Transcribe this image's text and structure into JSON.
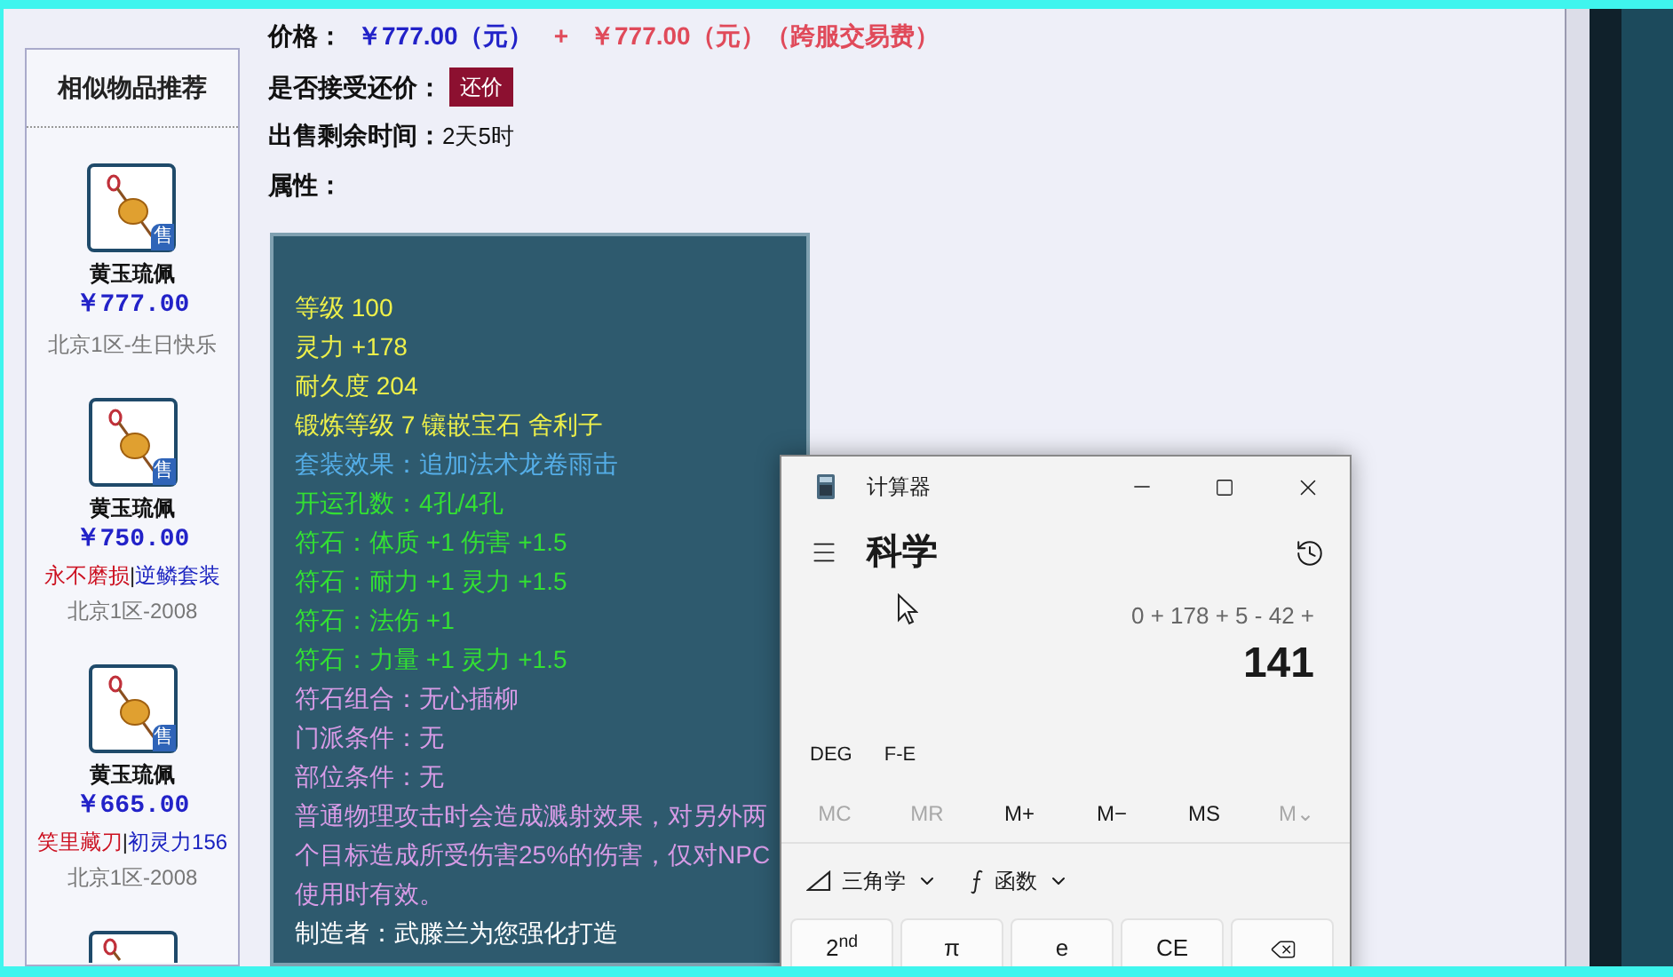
{
  "sidebar": {
    "title": "相似物品推荐",
    "items": [
      {
        "name": "黄玉琉佩",
        "badge": "售",
        "price": "￥777.00",
        "server": "北京1区-生日快乐"
      },
      {
        "name": "黄玉琉佩",
        "badge": "售",
        "price": "￥750.00",
        "tags": [
          {
            "text": "永不磨损",
            "kind": "special"
          },
          {
            "text": "|",
            "kind": "separator"
          },
          {
            "text": "逆鳞套装",
            "kind": "set"
          }
        ],
        "server": "北京1区-2008"
      },
      {
        "name": "黄玉琉佩",
        "badge": "售",
        "price": "￥665.00",
        "tags": [
          {
            "text": "笑里藏刀",
            "kind": "special"
          },
          {
            "text": "|",
            "kind": "separator"
          },
          {
            "text": "初灵力156",
            "kind": "set"
          }
        ],
        "server": "北京1区-2008"
      },
      {
        "kind": "partial"
      }
    ]
  },
  "details": {
    "price_label": "价格：",
    "price": "￥777.00（元）",
    "plus": "+",
    "fee": "￥777.00（元）（跨服交易费）",
    "bargain_label": "是否接受还价：",
    "bargain_button": "还价",
    "time_label": "出售剩余时间：",
    "time_value": "2天5时",
    "attributes_label": "属性：",
    "attributes": [
      {
        "text": "等级 100",
        "kind": "stat"
      },
      {
        "text": "灵力 +178",
        "kind": "stat"
      },
      {
        "text": "耐久度 204",
        "kind": "stat"
      },
      {
        "text": "锻炼等级 7 镶嵌宝石 舍利子",
        "kind": "stat"
      },
      {
        "text": "套装效果：追加法术龙卷雨击",
        "kind": "set"
      },
      {
        "text": "开运孔数：4孔/4孔",
        "kind": "rune"
      },
      {
        "text": "符石：体质 +1 伤害 +1.5",
        "kind": "rune"
      },
      {
        "text": "符石：耐力 +1 灵力 +1.5",
        "kind": "rune"
      },
      {
        "text": "符石：法伤 +1",
        "kind": "rune"
      },
      {
        "text": "符石：力量 +1 灵力 +1.5",
        "kind": "rune"
      },
      {
        "text": "符石组合：无心插柳",
        "kind": "special"
      },
      {
        "text": "门派条件：无",
        "kind": "special"
      },
      {
        "text": "部位条件：无",
        "kind": "special"
      },
      {
        "text": "普通物理攻击时会造成溅射效果，对另外两个目标造成所受伤害25%的伤害，仅对NPC使用时有效。",
        "kind": "special"
      },
      {
        "text": "制造者：武滕兰为您强化打造",
        "kind": "maker"
      }
    ]
  },
  "calculator": {
    "title": "计算器",
    "mode": "科学",
    "expression": "0 + 178 + 5 - 42 +",
    "result": "141",
    "mode_buttons": [
      "DEG",
      "F-E"
    ],
    "memory_buttons": [
      {
        "label": "MC",
        "disabled": true
      },
      {
        "label": "MR",
        "disabled": true
      },
      {
        "label": "M+",
        "disabled": false
      },
      {
        "label": "M−",
        "disabled": false
      },
      {
        "label": "MS",
        "disabled": false
      },
      {
        "label": "M⌄",
        "disabled": true
      }
    ],
    "dropdowns": [
      {
        "label": "三角学",
        "kind": "trig"
      },
      {
        "label": "函数",
        "kind": "function"
      }
    ],
    "keys": [
      {
        "kind": "text",
        "label": "2$^{nd}$"
      },
      {
        "kind": "text",
        "label": "π"
      },
      {
        "kind": "text",
        "label": "e"
      },
      {
        "kind": "text",
        "label": "CE"
      },
      {
        "kind": "backspace"
      }
    ]
  }
}
